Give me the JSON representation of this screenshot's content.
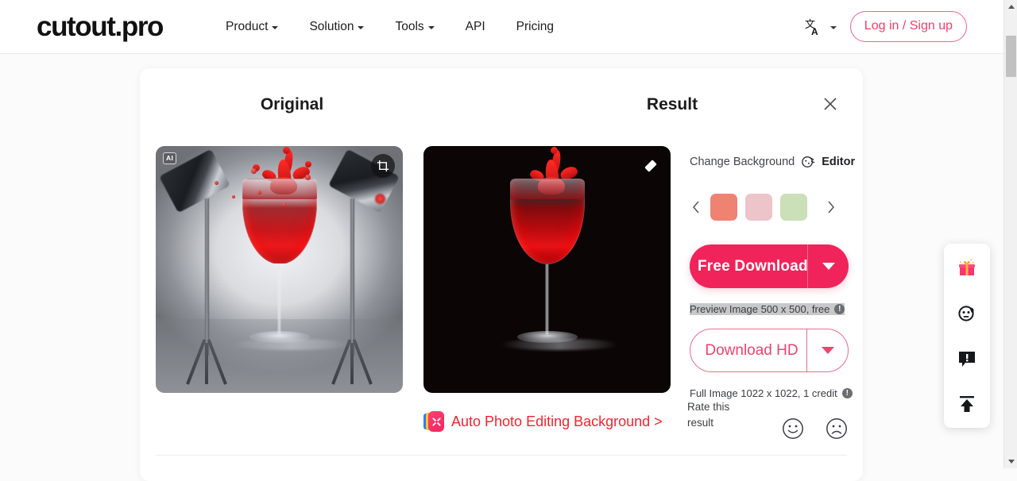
{
  "header": {
    "logo": "cutout.pro",
    "nav": [
      {
        "label": "Product",
        "has_caret": true
      },
      {
        "label": "Solution",
        "has_caret": true
      },
      {
        "label": "Tools",
        "has_caret": true
      },
      {
        "label": "API",
        "has_caret": false
      },
      {
        "label": "Pricing",
        "has_caret": false
      }
    ],
    "language_icon": "translate-icon",
    "login_label": "Log in / Sign up"
  },
  "card": {
    "original_title": "Original",
    "result_title": "Result",
    "close_icon": "close-icon",
    "original_image": {
      "badge": "AI",
      "corner_icon": "crop-icon",
      "alt": "Wine glass with red wine splash on gray studio backdrop with two studio lights"
    },
    "result_image": {
      "corner_icon": "eraser-icon",
      "alt": "Wine glass with red wine splash on black background"
    }
  },
  "controls": {
    "change_background_label": "Change Background",
    "editor_label": "Editor",
    "editor_icon": "magic-edit-icon",
    "prev_icon": "chevron-left-icon",
    "next_icon": "chevron-right-icon",
    "swatches": [
      {
        "name": "coral",
        "color": "#f08272"
      },
      {
        "name": "pink",
        "color": "#eec4cb"
      },
      {
        "name": "green",
        "color": "#cbdfb8"
      }
    ],
    "free_download_label": "Free Download",
    "free_download_hint": "Preview Image 500 x 500, free",
    "download_hd_label": "Download HD",
    "download_hd_hint": "Full Image 1022 x 1022, 1 credit",
    "info_icon": "info-icon",
    "dropdown_icon": "chevron-down-icon",
    "accent_color": "#f0245a"
  },
  "promo": {
    "icon": "auto-photo-editing-icon",
    "label": "Auto Photo Editing Background >"
  },
  "rating": {
    "label": "Rate this result",
    "happy_icon": "smiley-happy-icon",
    "sad_icon": "smiley-sad-icon"
  },
  "widget": {
    "items": [
      {
        "name": "gift-icon"
      },
      {
        "name": "avatar-face-icon"
      },
      {
        "name": "feedback-icon"
      },
      {
        "name": "scroll-to-top-icon"
      }
    ]
  },
  "scrollbar": {
    "up_icon": "scroll-up-arrow-icon",
    "down_icon": "scroll-down-arrow-icon"
  }
}
